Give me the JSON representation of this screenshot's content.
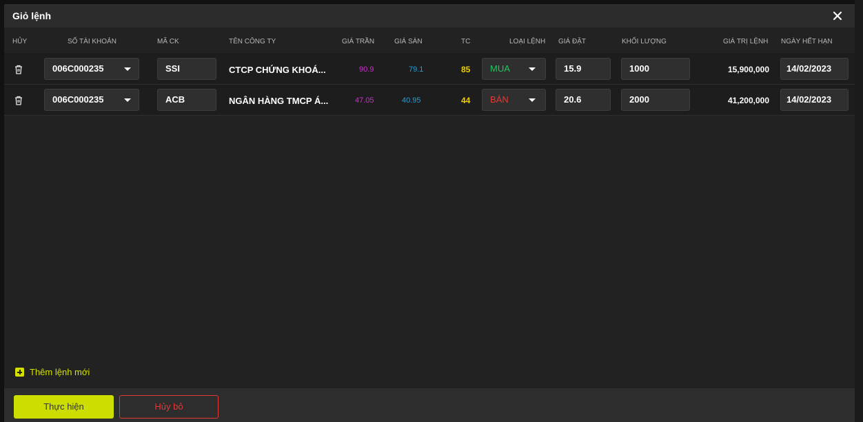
{
  "modal": {
    "title": "Giỏ lệnh"
  },
  "columns": {
    "cancel": "HỦY",
    "account": "SỐ TÀI KHOẢN",
    "symbol": "MÃ CK",
    "company": "TÊN CÔNG TY",
    "ceiling": "GIÁ TRẦN",
    "floor": "GIÁ SÀN",
    "reference": "TC",
    "order_type": "LOẠI LỆNH",
    "price": "GIÁ ĐẶT",
    "quantity": "KHỐI LƯỢNG",
    "order_value": "GIÁ TRỊ LỆNH",
    "expiry": "NGÀY HẾT HẠN"
  },
  "rows": [
    {
      "account": "006C000235",
      "symbol": "SSI",
      "company": "CTCP CHỨNG KHOÁ...",
      "ceiling": "90.9",
      "floor": "79.1",
      "reference": "85",
      "order_type": "MUA",
      "price": "15.9",
      "quantity": "1000",
      "order_value": "15,900,000",
      "expiry": "14/02/2023"
    },
    {
      "account": "006C000235",
      "symbol": "ACB",
      "company": "NGÂN HÀNG TMCP Á...",
      "ceiling": "47.05",
      "floor": "40.95",
      "reference": "44",
      "order_type": "BÁN",
      "price": "20.6",
      "quantity": "2000",
      "order_value": "41,200,000",
      "expiry": "14/02/2023"
    }
  ],
  "actions": {
    "add_order": "Thêm lệnh mới",
    "submit": "Thực hiện",
    "cancel": "Hủy bỏ"
  },
  "colors": {
    "ceiling": "#d62ad6",
    "floor": "#1ea0e0",
    "reference": "#f0d000",
    "buy": "#22c55e",
    "sell": "#e53935",
    "accent": "#ccdd00"
  },
  "icons": {
    "close": "close-icon",
    "delete": "trash-icon",
    "dropdown": "chevron-down-icon",
    "add": "plus-square-icon"
  }
}
